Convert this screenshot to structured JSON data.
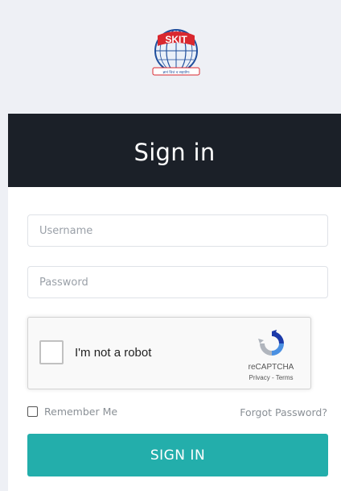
{
  "logo": {
    "name": "skit-logo",
    "text": "SKIT",
    "tagline": "ज्ञानं वित्तं च सहयोगः",
    "colors": {
      "red": "#d9282f",
      "blue": "#1f4e9c"
    }
  },
  "card": {
    "title": "Sign in",
    "header_color": "#1b2028"
  },
  "form": {
    "username": {
      "placeholder": "Username",
      "value": ""
    },
    "password": {
      "placeholder": "Password",
      "value": ""
    },
    "remember_label": "Remember Me",
    "forgot_label": "Forgot Password?",
    "submit_label": "SIGN IN",
    "accent_color": "#23aeab"
  },
  "captcha": {
    "label": "I'm not a robot",
    "brand": "reCAPTCHA",
    "privacy": "Privacy",
    "separator": " - ",
    "terms": "Terms",
    "checked": false
  }
}
